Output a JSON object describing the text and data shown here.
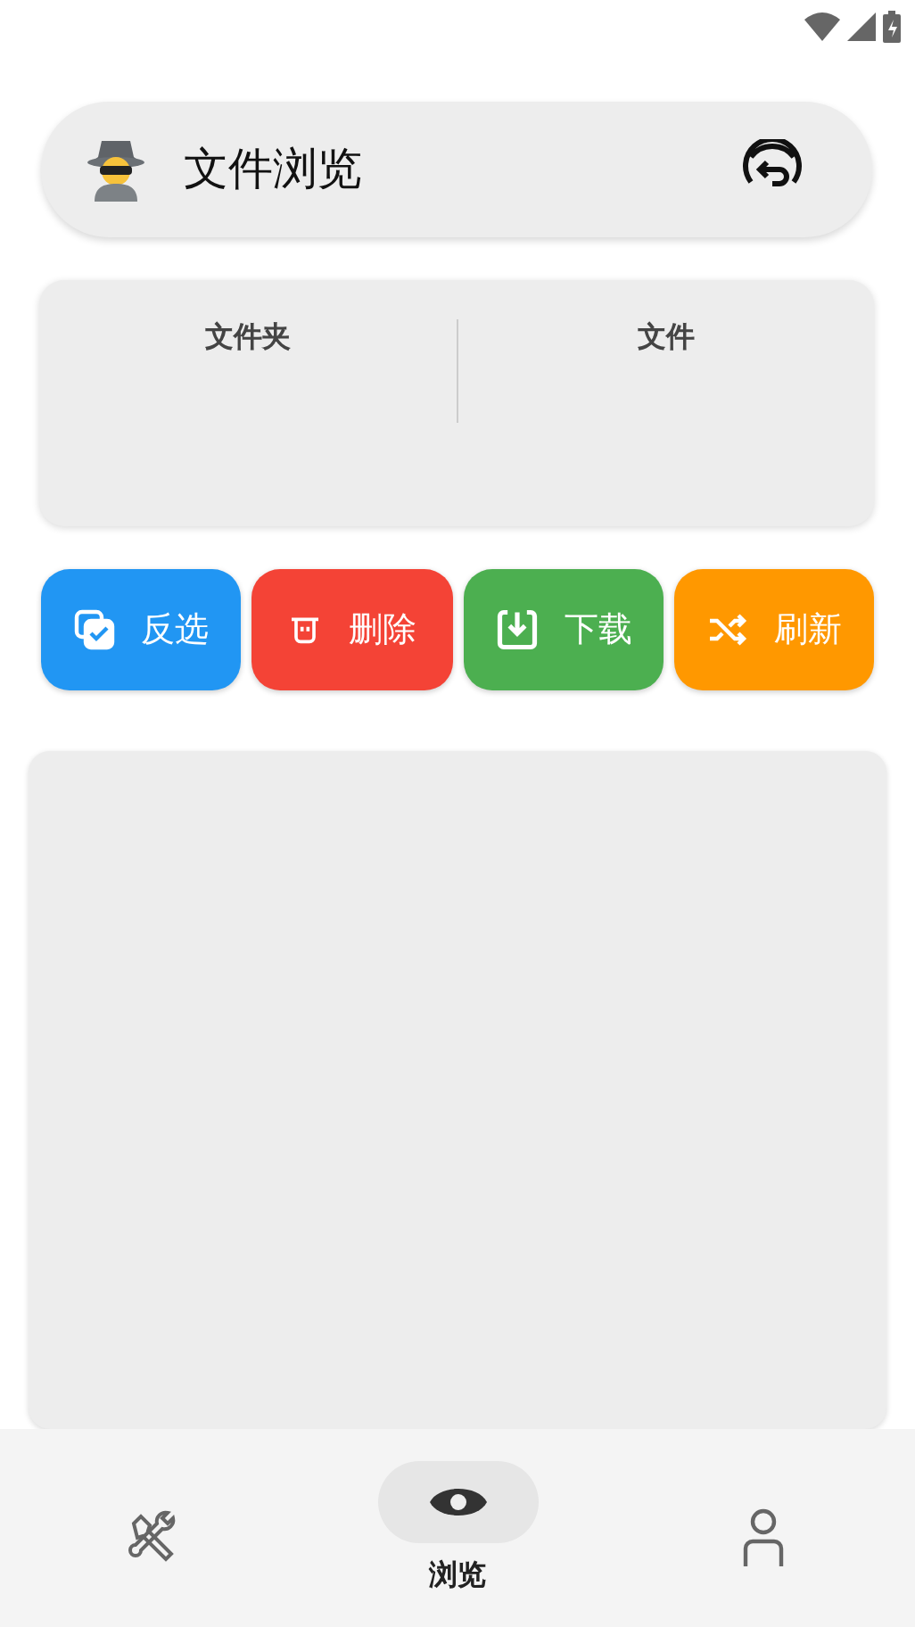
{
  "header": {
    "title": "文件浏览"
  },
  "tabs": [
    {
      "label": "文件夹"
    },
    {
      "label": "文件"
    }
  ],
  "actions": [
    {
      "kind": "invert",
      "label": "反选",
      "color": "#2196f3"
    },
    {
      "kind": "delete",
      "label": "删除",
      "color": "#f44336"
    },
    {
      "kind": "download",
      "label": "下载",
      "color": "#4caf50"
    },
    {
      "kind": "refresh",
      "label": "刷新",
      "color": "#ff9800"
    }
  ],
  "nav": [
    {
      "kind": "tools",
      "selected": false
    },
    {
      "kind": "eye",
      "selected": true,
      "label": "浏览"
    },
    {
      "kind": "person",
      "selected": false
    }
  ]
}
